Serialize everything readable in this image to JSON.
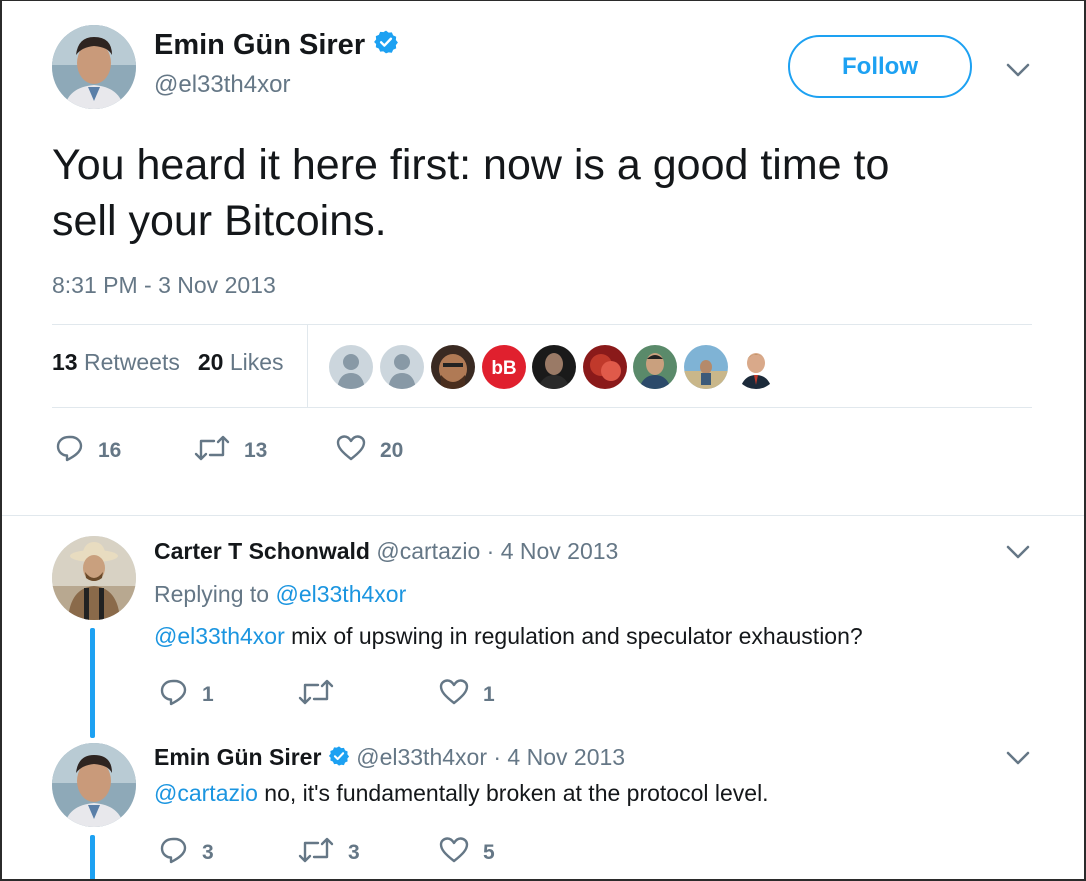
{
  "main_tweet": {
    "author_name": "Emin Gün Sirer",
    "handle": "@el33th4xor",
    "follow_label": "Follow",
    "text_line1": "You heard it here first: now is a good time to",
    "text_line2": "sell your Bitcoins.",
    "timestamp": "8:31 PM - 3 Nov 2013",
    "retweets_count": "13",
    "retweets_label": "Retweets",
    "likes_count": "20",
    "likes_label": "Likes",
    "liker_badge_text": "bB",
    "reply_count": "16",
    "retweet_action_count": "13",
    "like_action_count": "20"
  },
  "replies": [
    {
      "author_name": "Carter T Schonwald",
      "handle": "@cartazio",
      "date": "· 4 Nov 2013",
      "replying_prefix": "Replying to",
      "replying_handle": "@el33th4xor",
      "mention": "@el33th4xor",
      "text": " mix of upswing in regulation and speculator exhaustion?",
      "reply_count": "1",
      "retweet_count": "",
      "like_count": "1"
    },
    {
      "author_name": "Emin Gün Sirer",
      "handle": "@el33th4xor",
      "date": "· 4 Nov 2013",
      "mention": "@cartazio",
      "text": " no, it's fundamentally broken at the protocol level.",
      "reply_count": "3",
      "retweet_count": "3",
      "like_count": "5"
    }
  ],
  "colors": {
    "accent": "#1da1f2",
    "link": "#1b95e0",
    "muted": "#657786",
    "text": "#14171a",
    "divider": "#e1e8ed",
    "verified": "#1da1f2"
  }
}
